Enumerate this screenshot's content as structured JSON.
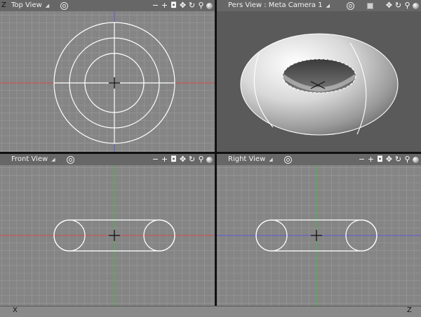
{
  "viewports": {
    "top": {
      "title": "Top View"
    },
    "pers": {
      "title": "Pers View : Meta Camera 1"
    },
    "front": {
      "title": "Front View"
    },
    "right": {
      "title": "Right View"
    }
  },
  "toolbar_icons": [
    "minus-icon",
    "plus-icon",
    "camera-icon",
    "move-icon",
    "rotate-icon",
    "zoom-icon",
    "shade-ball-icon"
  ],
  "toolbar_glyphs": {
    "minus": "−",
    "plus": "+",
    "camera": "◘",
    "move": "✥",
    "rotate": "↻",
    "zoom": "⚲"
  },
  "axis_labels": {
    "top_left": "Z",
    "bottom_left": "X",
    "bottom_right": "Z"
  },
  "colors": {
    "background": "#858585",
    "grid": "#9a9a9a",
    "x_axis": "#d24b4b",
    "y_axis": "#3fc03f",
    "z_axis": "#5a5ad6",
    "wire": "#ffffff",
    "pers_background": "#5a5a5a"
  }
}
